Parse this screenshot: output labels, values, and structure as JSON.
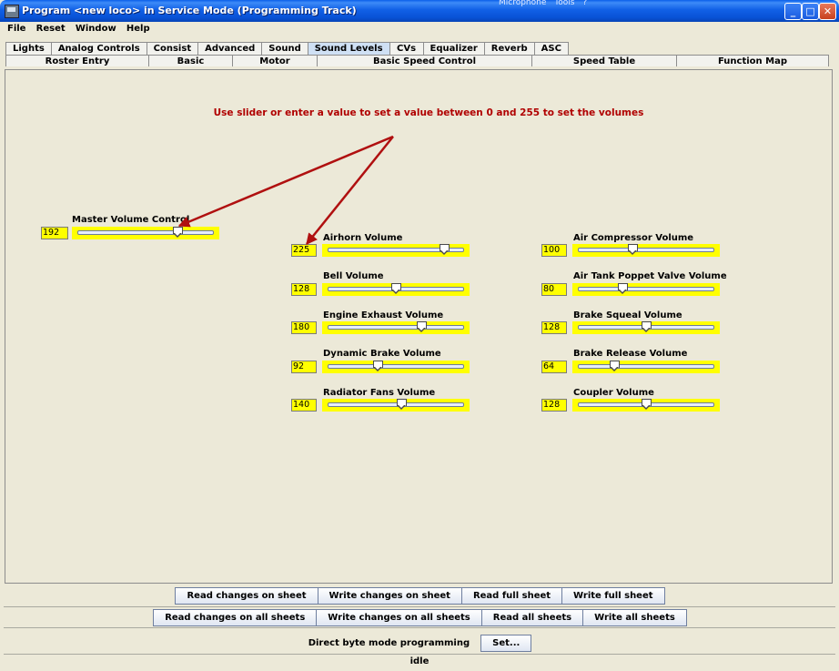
{
  "window": {
    "title": "Program <new loco> in Service Mode (Programming Track)",
    "tray": [
      "Microphone",
      "Tools",
      "?"
    ]
  },
  "menu": [
    "File",
    "Reset",
    "Window",
    "Help"
  ],
  "tabs_row1": [
    {
      "label": "Lights",
      "w": 43
    },
    {
      "label": "Analog Controls",
      "w": 86
    },
    {
      "label": "Consist",
      "w": 52
    },
    {
      "label": "Advanced",
      "w": 60
    },
    {
      "label": "Sound",
      "w": 48
    },
    {
      "label": "Sound Levels",
      "w": 80,
      "active": true
    },
    {
      "label": "CVs",
      "w": 36
    },
    {
      "label": "Equalizer",
      "w": 59
    },
    {
      "label": "Reverb",
      "w": 50
    },
    {
      "label": "ASC",
      "w": 36
    }
  ],
  "tabs_row2": [
    {
      "label": "Roster Entry",
      "w": 158
    },
    {
      "label": "Basic",
      "w": 93
    },
    {
      "label": "Motor",
      "w": 94
    },
    {
      "label": "Basic Speed Control",
      "w": 237
    },
    {
      "label": "Speed Table",
      "w": 160
    },
    {
      "label": "Function Map",
      "w": 168
    }
  ],
  "instruction": "Use slider or enter a value to set a value between 0 and 255 to set the volumes",
  "max_value": 255,
  "volumes": [
    {
      "label": "Master Volume Control",
      "value": "192",
      "frac": 192
    },
    {
      "label": "Airhorn Volume",
      "value": "225",
      "frac": 225
    },
    {
      "label": "Bell Volume",
      "value": "128",
      "frac": 128
    },
    {
      "label": "Engine Exhaust Volume",
      "value": "180",
      "frac": 180
    },
    {
      "label": "Dynamic Brake Volume",
      "value": "92",
      "frac": 92
    },
    {
      "label": "Radiator Fans Volume",
      "value": "140",
      "frac": 140
    },
    {
      "label": "Air Compressor Volume",
      "value": "100",
      "frac": 100
    },
    {
      "label": "Air Tank Poppet Valve Volume",
      "value": "80",
      "frac": 80
    },
    {
      "label": "Brake Squeal Volume",
      "value": "128",
      "frac": 128
    },
    {
      "label": "Brake Release Volume",
      "value": "64",
      "frac": 64
    },
    {
      "label": "Coupler Volume",
      "value": "128",
      "frac": 128
    }
  ],
  "buttons_sheet": [
    "Read changes on sheet",
    "Write changes on sheet",
    "Read full sheet",
    "Write full sheet"
  ],
  "buttons_all": [
    "Read changes on all sheets",
    "Write changes on all sheets",
    "Read all sheets",
    "Write all sheets"
  ],
  "direct_label": "Direct byte mode programming",
  "set_button": "Set...",
  "status": "idle",
  "colors": {
    "highlight": "#FFFF00",
    "instruction": "#B00000",
    "arrow": "#B01010"
  }
}
